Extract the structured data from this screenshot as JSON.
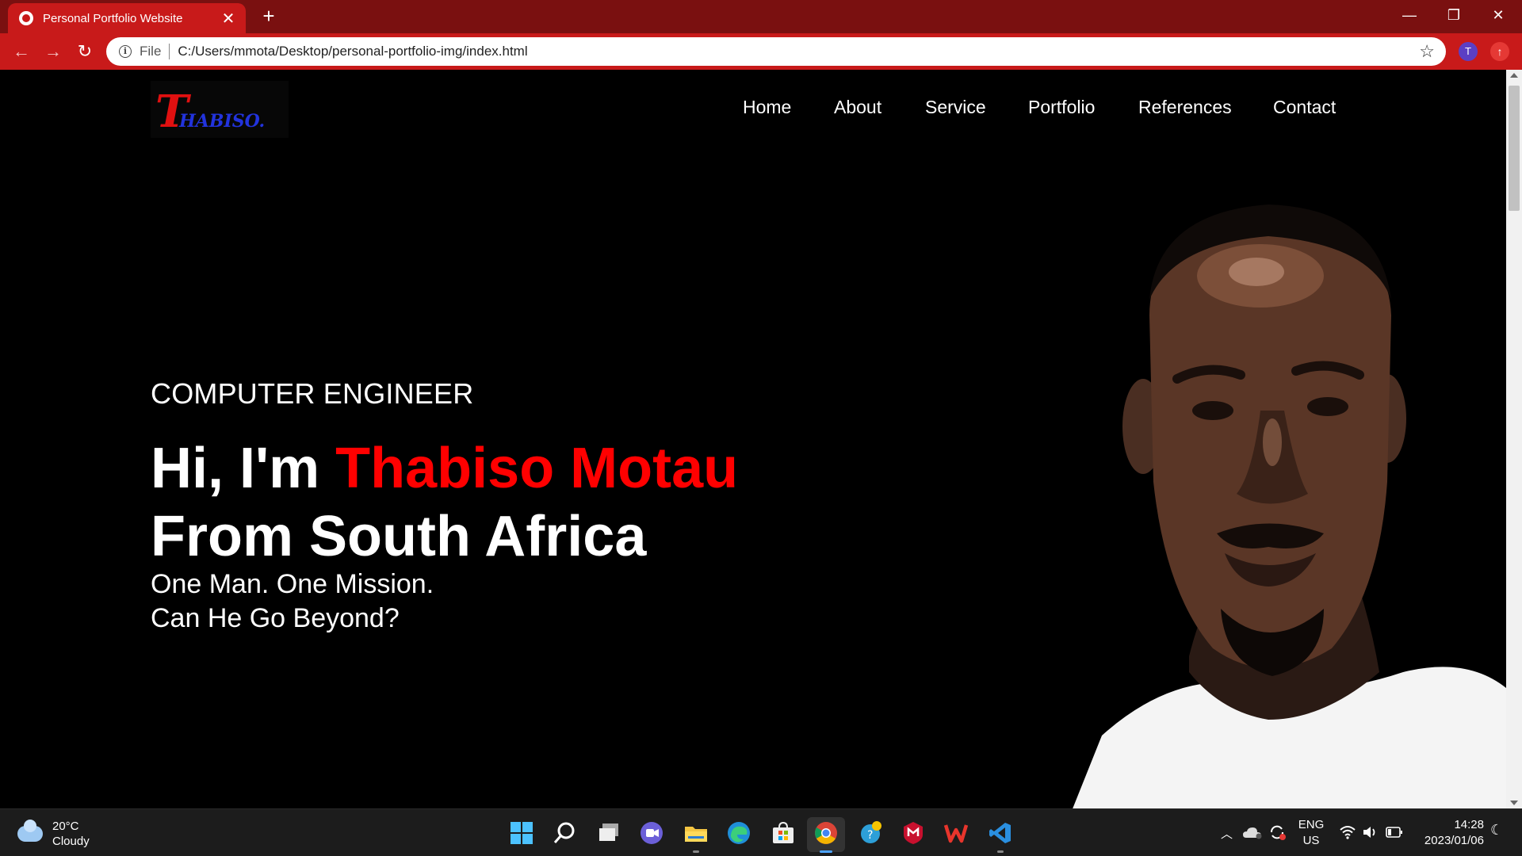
{
  "browser": {
    "tab_title": "Personal Portfolio Website",
    "new_tab": "+",
    "url_scheme": "File",
    "url": "C:/Users/mmota/Desktop/personal-portfolio-img/index.html",
    "profile_initial": "T",
    "accent_color": "#c81a1a",
    "frame_color": "#7a1010"
  },
  "page": {
    "logo": {
      "initial": "T",
      "rest": "HABISO."
    },
    "nav": [
      "Home",
      "About",
      "Service",
      "Portfolio",
      "References",
      "Contact"
    ],
    "subtitle": "COMPUTER ENGINEER",
    "headline": {
      "greeting": "Hi, I'm ",
      "name": "Thabiso Motau",
      "line2": "From South Africa"
    },
    "tagline": [
      "One Man. One Mission.",
      "Can He Go Beyond?"
    ],
    "name_color": "#ff0000"
  },
  "taskbar": {
    "weather": {
      "temp": "20°C",
      "condition": "Cloudy"
    },
    "apps": [
      "start-icon",
      "search-icon",
      "task-view-icon",
      "teams-chat-icon",
      "file-explorer-icon",
      "edge-icon",
      "store-icon",
      "chrome-icon",
      "settings-icon",
      "mcafee-icon",
      "wps-office-icon",
      "vscode-icon"
    ],
    "language": {
      "lang": "ENG",
      "region": "US"
    },
    "time": "14:28",
    "date": "2023/01/06"
  }
}
